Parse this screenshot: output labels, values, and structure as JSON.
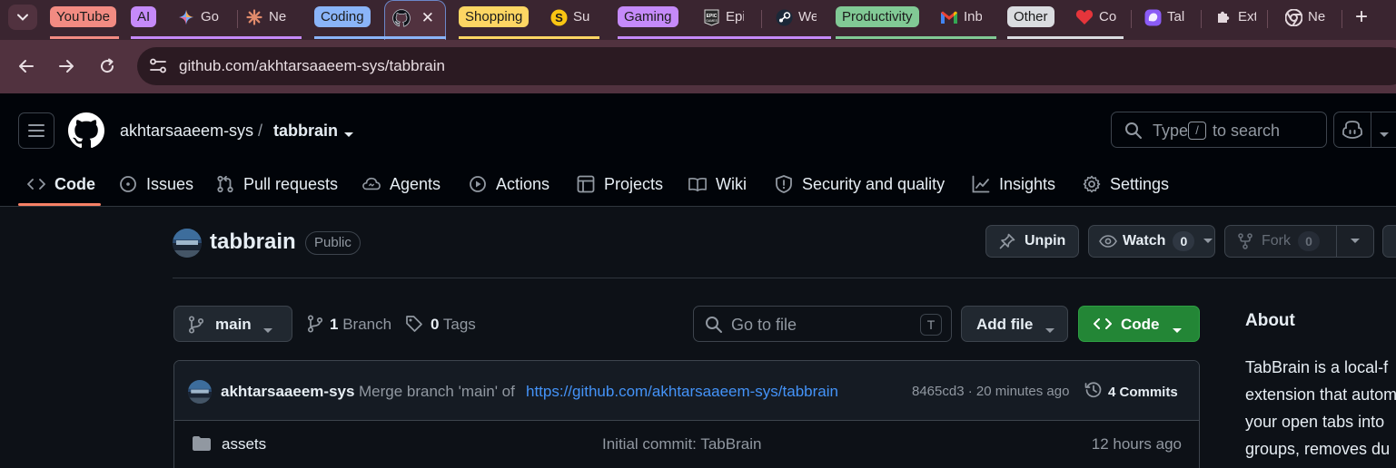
{
  "browser": {
    "tab_groups": [
      {
        "label": "YouTube",
        "color": "#f28b82"
      },
      {
        "label": "AI",
        "color": "#c58af9"
      },
      {
        "label": "Coding",
        "color": "#8ab4f8"
      },
      {
        "label": "Shopping",
        "color": "#fdd663"
      },
      {
        "label": "Gaming",
        "color": "#c58af9"
      },
      {
        "label": "Productivity",
        "color": "#81c995"
      },
      {
        "label": "Other",
        "color": "#dadce0"
      }
    ],
    "tabs": [
      {
        "title": "Go",
        "icon": "gemini-icon"
      },
      {
        "title": "Ne",
        "icon": "claude-icon"
      },
      {
        "title": "",
        "icon": "github-icon"
      },
      {
        "title": "Su",
        "icon": "s-coin-icon"
      },
      {
        "title": "Epi",
        "icon": "epic-games-icon"
      },
      {
        "title": "We",
        "icon": "steam-icon"
      },
      {
        "title": "Inb",
        "icon": "gmail-icon"
      },
      {
        "title": "Co",
        "icon": "heart-icon"
      },
      {
        "title": "Tal",
        "icon": "tabbrain-icon"
      },
      {
        "title": "Ext",
        "icon": "extensions-icon"
      },
      {
        "title": "Ne",
        "icon": "chrome-icon"
      }
    ],
    "url": "github.com/akhtarsaaeem-sys/tabbrain"
  },
  "header": {
    "owner": "akhtarsaaeem-sys",
    "separator": "/",
    "repo": "tabbrain",
    "search_pre": "Type",
    "search_key": "/",
    "search_post": "to search"
  },
  "nav": [
    {
      "label": "Code",
      "icon": "code-icon"
    },
    {
      "label": "Issues",
      "icon": "issue-icon"
    },
    {
      "label": "Pull requests",
      "icon": "pull-request-icon"
    },
    {
      "label": "Agents",
      "icon": "agents-icon"
    },
    {
      "label": "Actions",
      "icon": "play-icon"
    },
    {
      "label": "Projects",
      "icon": "table-icon"
    },
    {
      "label": "Wiki",
      "icon": "book-icon"
    },
    {
      "label": "Security and quality",
      "icon": "shield-icon"
    },
    {
      "label": "Insights",
      "icon": "graph-icon"
    },
    {
      "label": "Settings",
      "icon": "gear-icon"
    }
  ],
  "repo": {
    "name": "tabbrain",
    "visibility": "Public",
    "unpin_label": "Unpin",
    "watch_label": "Watch",
    "watch_count": "0",
    "fork_label": "Fork",
    "fork_count": "0"
  },
  "toolbar": {
    "branch": "main",
    "branch_count": "1",
    "branch_word": "Branch",
    "tag_count": "0",
    "tag_word": "Tags",
    "goto_placeholder": "Go to file",
    "goto_key": "T",
    "add_file_label": "Add file",
    "code_label": "Code"
  },
  "commit": {
    "author": "akhtarsaaeem-sys",
    "message": "Merge branch 'main' of",
    "link": "https://github.com/akhtarsaaeem-sys/tabbrain",
    "hash_time": "8465cd3 · 20 minutes ago",
    "commits_label": "4 Commits"
  },
  "files": [
    {
      "name": "assets",
      "message": "Initial commit: TabBrain",
      "time": "12 hours ago"
    }
  ],
  "about": {
    "title": "About",
    "lines": [
      "TabBrain is a local-f",
      "extension that autom",
      "your open tabs into",
      "groups, removes du"
    ]
  }
}
